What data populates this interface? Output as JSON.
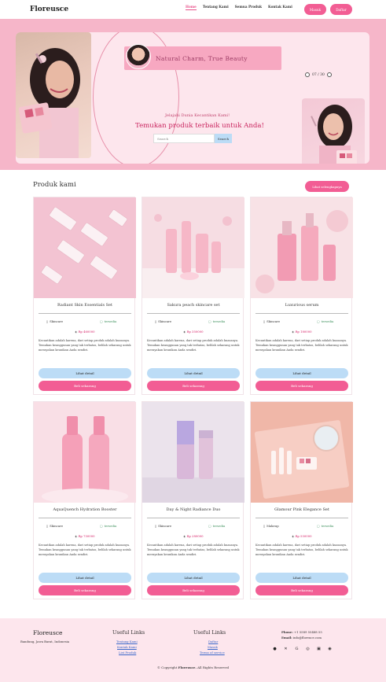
{
  "nav": {
    "brand": "Floreusce",
    "links": [
      "Home",
      "Tentang Kami",
      "Semua Produk",
      "Kontak Kami"
    ],
    "login": "Masuk",
    "register": "Daftar"
  },
  "hero": {
    "tagline": "Natural Charm, True Beauty",
    "counter": "07 / 30",
    "subtitle": "Jelajahi Dunia Kecantikan Kami!",
    "title": "Temukan produk terbaik untuk Anda!",
    "search_placeholder": "Search",
    "search_button": "Search"
  },
  "products": {
    "section_title": "Produk kami",
    "see_all": "Lihat selengkapnya",
    "items": [
      {
        "name": "Radiant Skin Essentials Set",
        "category": "Skincare",
        "stock": "tersedia",
        "price": "Rp 460000",
        "desc": "Kecantikan adalah karena, dari setiap produk adalah kuasanya. Temukan keanggunan yang tak terbatas, belilah sekarang untuk merayakan keunikan Anda sendiri.",
        "detail": "Lihat detail",
        "buy": "Beli sekarang"
      },
      {
        "name": "Sakura peach skincare set",
        "category": "Skincare",
        "stock": "tersedia",
        "price": "Rp 350000",
        "desc": "Kecantikan adalah karena, dari setiap produk adalah kuasanya. Temukan keanggunan yang tak terbatas, belilah sekarang untuk merayakan keunikan Anda sendiri.",
        "detail": "Lihat detail",
        "buy": "Beli sekarang"
      },
      {
        "name": "Luxurious serum",
        "category": "Skincare",
        "stock": "tersedia",
        "price": "Rp 180000",
        "desc": "Kecantikan adalah karena, dari setiap produk adalah kuasanya. Temukan keanggunan yang tak terbatas, belilah sekarang untuk merayakan keunikan Anda sendiri.",
        "detail": "Lihat detail",
        "buy": "Beli sekarang"
      },
      {
        "name": "AquaQuench Hydration Booster",
        "category": "Skincare",
        "stock": "tersedia",
        "price": "Rp 750000",
        "desc": "Kecantikan adalah karena, dari setiap produk adalah kuasanya. Temukan keanggunan yang tak terbatas, belilah sekarang untuk merayakan keunikan Anda sendiri.",
        "detail": "Lihat detail",
        "buy": "Beli sekarang"
      },
      {
        "name": "Day & Night Radiance Duo",
        "category": "Skincare",
        "stock": "tersedia",
        "price": "Rp 280000",
        "desc": "Kecantikan adalah karena, dari setiap produk adalah kuasanya. Temukan keanggunan yang tak terbatas, belilah sekarang untuk merayakan keunikan Anda sendiri.",
        "detail": "Lihat detail",
        "buy": "Beli sekarang"
      },
      {
        "name": "Glamour Pink Elegance Set",
        "category": "Makeup",
        "stock": "tersedia",
        "price": "Rp 550000",
        "desc": "Kecantikan adalah karena, dari setiap produk adalah kuasanya. Temukan keanggunan yang tak terbatas, belilah sekarang untuk merayakan keunikan Anda sendiri.",
        "detail": "Lihat detail",
        "buy": "Beli sekarang"
      }
    ]
  },
  "footer": {
    "brand": "Floreusce",
    "address": "Bandung, Jawa Barat, Indonesia",
    "col1_title": "Useful Links",
    "col1_links": [
      "Tentang Kami",
      "Kontak Kami",
      "List Produk"
    ],
    "col2_title": "Useful Links",
    "col2_links": [
      "Daftar",
      "Masuk",
      "Terms of service"
    ],
    "phone_label": "Phone:",
    "phone": "+1 5589 55488 55",
    "email_label": "Email:",
    "email": "info@floreuce.com",
    "copyright_pre": "© Copyright",
    "copyright_brand": "Floreusce.",
    "copyright_post": "All Rights Reserved"
  },
  "colors": {
    "accent": "#f25d94",
    "hero_bg": "#f6b6c9",
    "soft_blue": "#bcdcf6"
  }
}
